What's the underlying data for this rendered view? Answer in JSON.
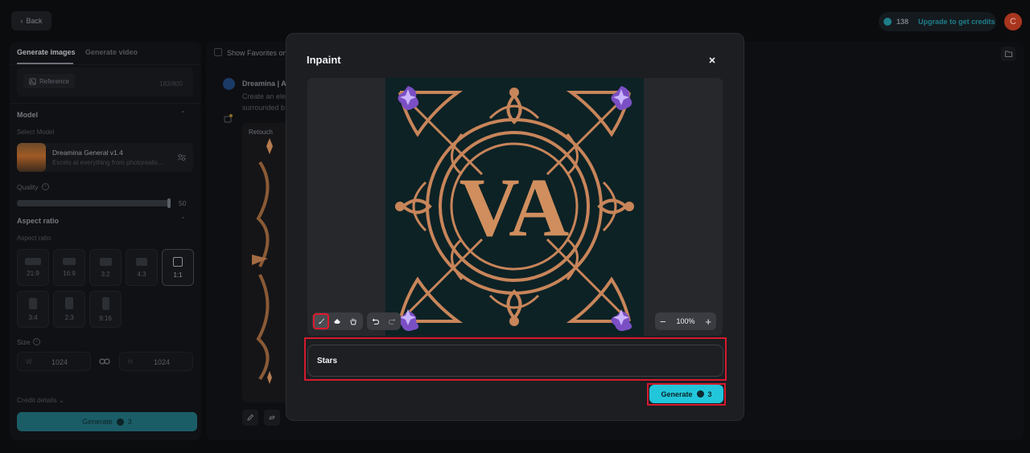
{
  "topbar": {
    "back_label": "Back",
    "credits": "138",
    "upgrade_label": "Upgrade to get credits",
    "avatar_letter": "C"
  },
  "left_panel": {
    "tabs": [
      "Generate images",
      "Generate video"
    ],
    "reference_label": "Reference",
    "char_counter": "183/800",
    "model_section": "Model",
    "select_model_label": "Select Model",
    "model_name": "Dreamina General v1.4",
    "model_desc": "Excels at everything from photorealis...",
    "quality_label": "Quality",
    "quality_value": "50",
    "aspect_section": "Aspect ratio",
    "aspect_label": "Aspect ratio",
    "ratios": [
      "21:9",
      "16:9",
      "3:2",
      "4:3",
      "1:1",
      "3:4",
      "2:3",
      "9:16"
    ],
    "selected_ratio": "1:1",
    "size_label": "Size",
    "width_prefix": "W",
    "width_value": "1024",
    "height_prefix": "H",
    "height_value": "1024",
    "credit_details_label": "Credit details",
    "generate_label": "Generate",
    "generate_cost": "3"
  },
  "feed": {
    "favorites_label": "Show Favorites on",
    "title": "Dreamina | AI",
    "line1": "Create an ele",
    "line2": "surrounded b",
    "retouch_label": "Retouch"
  },
  "modal": {
    "title": "Inpaint",
    "zoom_value": "100%",
    "prompt_value": "Stars",
    "generate_label": "Generate",
    "generate_cost": "3",
    "canvas_letters": "VA"
  },
  "colors": {
    "accent": "#22c6da",
    "highlight": "#d41a2d",
    "art_bg": "#0d2225",
    "art_gold": "#c8855a",
    "art_purple": "#7b4fc4"
  }
}
